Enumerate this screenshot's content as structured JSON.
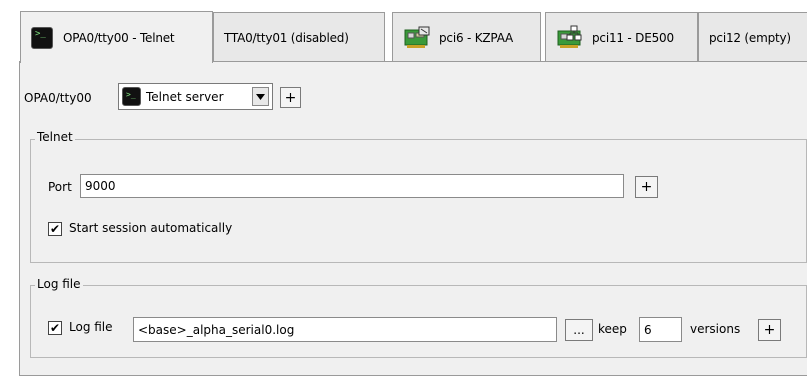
{
  "tabs": [
    {
      "label": "OPA0/tty00 - Telnet",
      "icon": "terminal-icon",
      "active": true
    },
    {
      "label": "TTA0/tty01 (disabled)",
      "icon": null,
      "active": false
    },
    {
      "label": "pci6 - KZPAA",
      "icon": "scsi-card-icon",
      "active": false
    },
    {
      "label": "pci11 - DE500",
      "icon": "network-card-icon",
      "active": false
    },
    {
      "label": "pci12 (empty)",
      "icon": null,
      "active": false
    }
  ],
  "device_row": {
    "label": "OPA0/tty00",
    "selected_value": "Telnet server",
    "add_label": "+"
  },
  "telnet_group": {
    "title": "Telnet",
    "port_label": "Port",
    "port_value": "9000",
    "add_label": "+",
    "auto_start_label": "Start session automatically",
    "auto_start_checked": true
  },
  "logfile_group": {
    "title": "Log file",
    "enabled_label": "Log file",
    "enabled_checked": true,
    "path_value": "<base>_alpha_serial0.log",
    "browse_label": "...",
    "keep_label": "keep",
    "versions_value": "6",
    "versions_label": "versions",
    "add_label": "+"
  },
  "colors": {
    "panel_bg": "#f0f0f0",
    "tab_bg": "#e8e8e8",
    "border": "#9a9a9a"
  }
}
